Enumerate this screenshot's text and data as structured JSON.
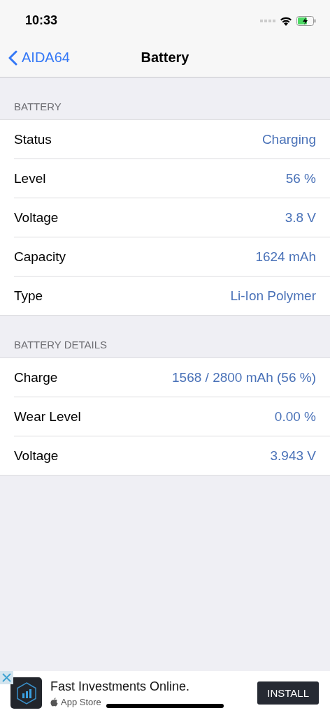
{
  "status_bar": {
    "time": "10:33"
  },
  "nav": {
    "back": "AIDA64",
    "title": "Battery"
  },
  "sections": [
    {
      "header": "BATTERY",
      "rows": [
        {
          "label": "Status",
          "value": "Charging"
        },
        {
          "label": "Level",
          "value": "56 %"
        },
        {
          "label": "Voltage",
          "value": "3.8 V"
        },
        {
          "label": "Capacity",
          "value": "1624 mAh"
        },
        {
          "label": "Type",
          "value": "Li-Ion Polymer"
        }
      ]
    },
    {
      "header": "BATTERY DETAILS",
      "rows": [
        {
          "label": "Charge",
          "value": "1568 / 2800 mAh (56 %)"
        },
        {
          "label": "Wear Level",
          "value": "0.00 %"
        },
        {
          "label": "Voltage",
          "value": "3.943 V"
        }
      ]
    }
  ],
  "ad": {
    "title": "Fast Investments Online.",
    "store": "App Store",
    "button": "INSTALL"
  }
}
